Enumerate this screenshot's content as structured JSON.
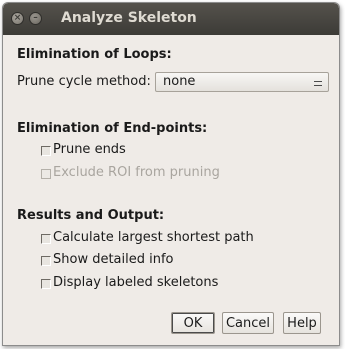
{
  "window": {
    "title": "Analyze Skeleton"
  },
  "loops": {
    "heading": "Elimination of Loops:",
    "prune_label": "Prune cycle method:",
    "prune_value": "none"
  },
  "endpoints": {
    "heading": "Elimination of End-points:",
    "prune_ends": {
      "label": "Prune ends",
      "checked": false
    },
    "exclude_roi": {
      "label": "Exclude ROI from pruning",
      "checked": false,
      "enabled": false
    }
  },
  "results": {
    "heading": "Results and Output:",
    "shortest_path": {
      "label": "Calculate largest shortest path",
      "checked": false
    },
    "detailed_info": {
      "label": "Show detailed info",
      "checked": false
    },
    "labeled": {
      "label": "Display labeled skeletons",
      "checked": false
    }
  },
  "buttons": {
    "ok": "OK",
    "cancel": "Cancel",
    "help": "Help"
  }
}
